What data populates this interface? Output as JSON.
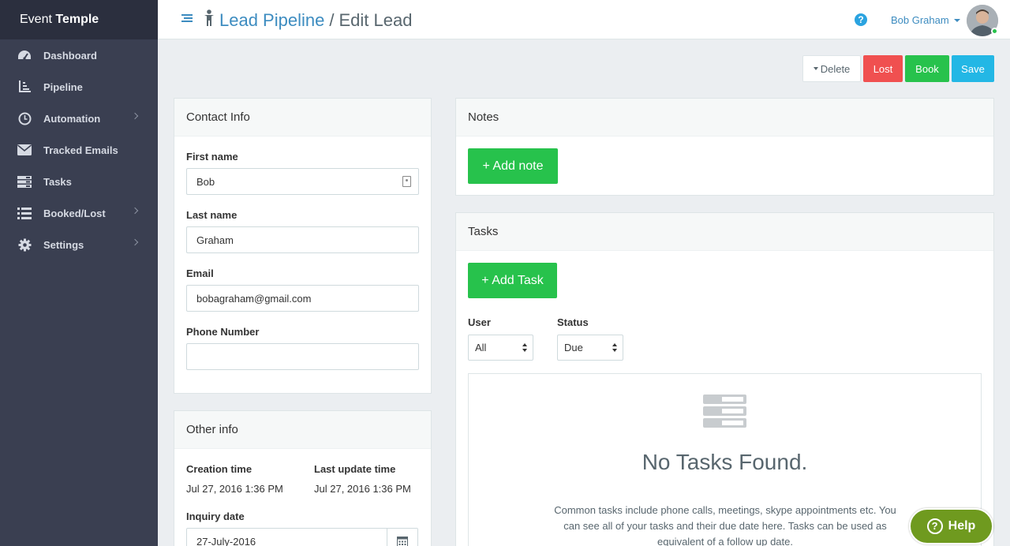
{
  "brand": {
    "light": "Event ",
    "bold": "Temple"
  },
  "sidebar": {
    "items": [
      {
        "label": "Dashboard",
        "icon": "dashboard-icon",
        "has_submenu": false
      },
      {
        "label": "Pipeline",
        "icon": "pipeline-icon",
        "has_submenu": false
      },
      {
        "label": "Automation",
        "icon": "clock-icon",
        "has_submenu": true
      },
      {
        "label": "Tracked Emails",
        "icon": "envelope-icon",
        "has_submenu": false
      },
      {
        "label": "Tasks",
        "icon": "tasks-icon",
        "has_submenu": false
      },
      {
        "label": "Booked/Lost",
        "icon": "list-icon",
        "has_submenu": true
      },
      {
        "label": "Settings",
        "icon": "gear-icon",
        "has_submenu": true
      }
    ]
  },
  "header": {
    "breadcrumb_link": "Lead Pipeline",
    "separator": "/",
    "current": "Edit Lead",
    "help_glyph": "?",
    "user_name": "Bob Graham"
  },
  "actions": {
    "delete": "Delete",
    "lost": "Lost",
    "book": "Book",
    "save": "Save"
  },
  "contact": {
    "title": "Contact Info",
    "first_name_label": "First name",
    "first_name": "Bob",
    "last_name_label": "Last name",
    "last_name": "Graham",
    "email_label": "Email",
    "email": "bobagraham@gmail.com",
    "phone_label": "Phone Number",
    "phone": ""
  },
  "other": {
    "title": "Other info",
    "creation_label": "Creation time",
    "creation_value": "Jul 27, 2016 1:36 PM",
    "update_label": "Last update time",
    "update_value": "Jul 27, 2016 1:36 PM",
    "inquiry_label": "Inquiry date",
    "inquiry_value": "27-July-2016"
  },
  "notes": {
    "title": "Notes",
    "add_label": "+ Add note"
  },
  "tasks": {
    "title": "Tasks",
    "add_label": "+ Add Task",
    "user_label": "User",
    "user_value": "All",
    "status_label": "Status",
    "status_value": "Due",
    "empty_title": "No Tasks Found.",
    "empty_text": "Common tasks include phone calls, meetings, skype appointments etc. You can see all of your tasks and their due date here. Tasks can be used as equivalent of a follow up date."
  },
  "help_button": {
    "glyph": "?",
    "label": "Help"
  },
  "colors": {
    "sidebar": "#3a3f51",
    "brand_bar": "#2b2f3e",
    "link_blue": "#3d8cc0",
    "danger": "#f05050",
    "success": "#27c24c",
    "info": "#23b7e5",
    "help_green": "#6f9a1f"
  }
}
